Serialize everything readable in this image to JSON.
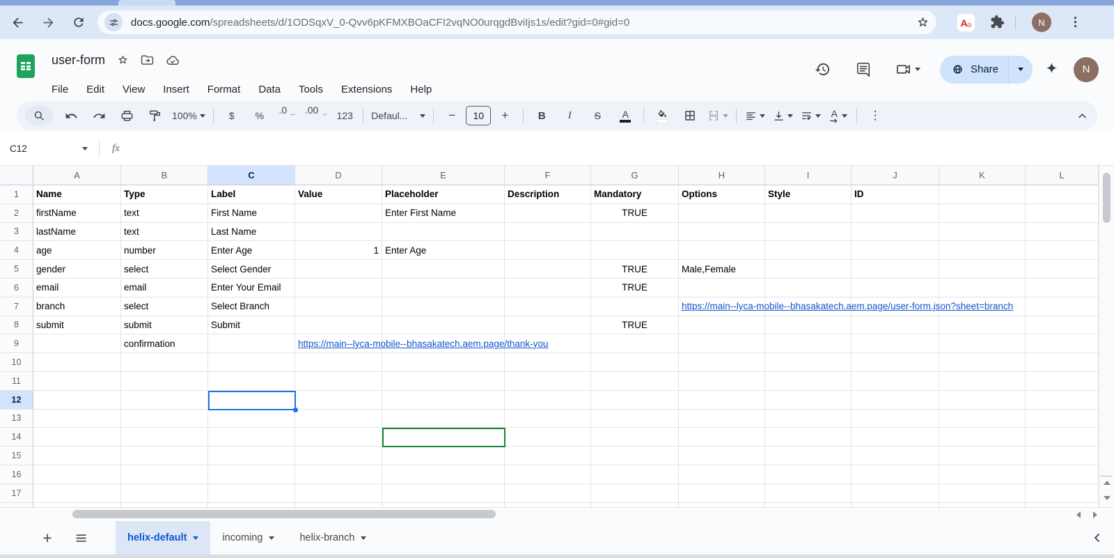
{
  "browser": {
    "url_host": "docs.google.com",
    "url_path": "/spreadsheets/d/1ODSqxV_0-Qvv6pKFMXBOaCFI2vqNO0urqgdBviIjs1s/edit?gid=0#gid=0",
    "extension_letter": "A",
    "avatar_letter": "N"
  },
  "header": {
    "title": "user-form",
    "menus": [
      "File",
      "Edit",
      "View",
      "Insert",
      "Format",
      "Data",
      "Tools",
      "Extensions",
      "Help"
    ],
    "share_label": "Share",
    "avatar_letter": "N"
  },
  "toolbar": {
    "zoom": "100%",
    "currency": "$",
    "percent": "%",
    "decimal_decrease": ".0",
    "decimal_decrease_arrow": "←",
    "decimal_increase": ".00",
    "decimal_increase_arrow": "→",
    "number_format": "123",
    "font_name": "Defaul...",
    "minus": "−",
    "font_size": "10",
    "plus": "+",
    "bold": "B",
    "italic": "I",
    "strikethrough": "S",
    "text_color_letter": "A",
    "fill_letter": "",
    "rotate_letter": "A",
    "more": "⋮"
  },
  "formula_bar": {
    "name_box": "C12",
    "fx_label": "fx",
    "content": ""
  },
  "grid": {
    "columns": [
      "A",
      "B",
      "C",
      "D",
      "E",
      "F",
      "G",
      "H",
      "I",
      "J",
      "K",
      "L"
    ],
    "row_count": 18,
    "selection": {
      "active": {
        "col": "C",
        "row": 12
      },
      "collaborator": {
        "col": "E",
        "row": 14
      }
    },
    "rows": [
      {
        "n": 1,
        "cells": [
          [
            "A",
            "Name",
            "b"
          ],
          [
            "B",
            "Type",
            "b"
          ],
          [
            "C",
            "Label",
            "b"
          ],
          [
            "D",
            "Value",
            "b"
          ],
          [
            "E",
            "Placeholder",
            "b"
          ],
          [
            "F",
            "Description",
            "b"
          ],
          [
            "G",
            "Mandatory",
            "b"
          ],
          [
            "H",
            "Options",
            "b"
          ],
          [
            "I",
            "Style",
            "b"
          ],
          [
            "J",
            "ID",
            "b"
          ]
        ]
      },
      {
        "n": 2,
        "cells": [
          [
            "A",
            "firstName",
            ""
          ],
          [
            "B",
            "text",
            ""
          ],
          [
            "C",
            "First Name",
            ""
          ],
          [
            "E",
            "Enter First Name",
            ""
          ],
          [
            "G",
            "TRUE",
            "c"
          ]
        ]
      },
      {
        "n": 3,
        "cells": [
          [
            "A",
            "lastName",
            ""
          ],
          [
            "B",
            "text",
            ""
          ],
          [
            "C",
            "Last Name",
            ""
          ]
        ]
      },
      {
        "n": 4,
        "cells": [
          [
            "A",
            "age",
            ""
          ],
          [
            "B",
            "number",
            ""
          ],
          [
            "C",
            "Enter Age",
            ""
          ],
          [
            "D",
            "1",
            "r"
          ],
          [
            "E",
            "Enter Age",
            ""
          ]
        ]
      },
      {
        "n": 5,
        "cells": [
          [
            "A",
            "gender",
            ""
          ],
          [
            "B",
            "select",
            ""
          ],
          [
            "C",
            "Select Gender",
            ""
          ],
          [
            "G",
            "TRUE",
            "c"
          ],
          [
            "H",
            "Male,Female",
            ""
          ]
        ]
      },
      {
        "n": 6,
        "cells": [
          [
            "A",
            "email",
            ""
          ],
          [
            "B",
            "email",
            ""
          ],
          [
            "C",
            "Enter Your Email",
            ""
          ],
          [
            "G",
            "TRUE",
            "c"
          ]
        ]
      },
      {
        "n": 7,
        "cells": [
          [
            "A",
            "branch",
            ""
          ],
          [
            "B",
            "select",
            ""
          ],
          [
            "C",
            "Select Branch",
            ""
          ],
          [
            "H",
            "https://main--lyca-mobile--bhasakatech.aem.page/user-form.json?sheet=branch",
            "L"
          ]
        ]
      },
      {
        "n": 8,
        "cells": [
          [
            "A",
            "submit",
            ""
          ],
          [
            "B",
            "submit",
            ""
          ],
          [
            "C",
            "Submit",
            ""
          ],
          [
            "G",
            "TRUE",
            "c"
          ]
        ]
      },
      {
        "n": 9,
        "cells": [
          [
            "B",
            "confirmation",
            ""
          ],
          [
            "D",
            "https://main--lyca-mobile--bhasakatech.aem.page/thank-you",
            "L"
          ]
        ]
      }
    ]
  },
  "sheet_tabs": {
    "tabs": [
      "helix-default",
      "incoming",
      "helix-branch"
    ],
    "active_index": 0
  },
  "colors": {
    "active_selection": "#1a73e8",
    "collaborator_selection": "#188038",
    "link": "#1155cc",
    "selected_header_bg": "#d3e3fd",
    "active_tab_text": "#0b57d0"
  }
}
